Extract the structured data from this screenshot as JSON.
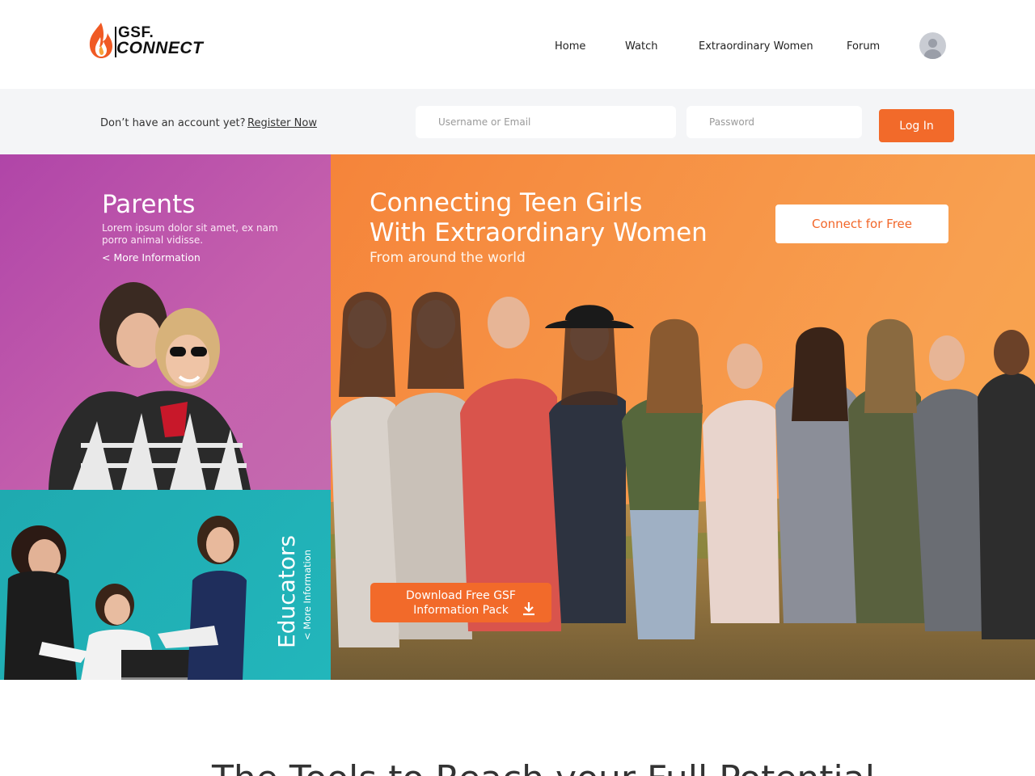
{
  "brand": {
    "name_top": "GSF.",
    "name_bottom": "CONNECT"
  },
  "nav": {
    "home": "Home",
    "watch": "Watch",
    "women": "Extraordinary Women",
    "forum": "Forum"
  },
  "login": {
    "prompt": "Don’t have an account yet?",
    "register_label": "Register Now",
    "username_placeholder": "Username or Email",
    "password_placeholder": "Password",
    "login_label": "Log In"
  },
  "parents": {
    "title": "Parents",
    "description": "Lorem ipsum dolor sit amet, ex nam porro animal vidisse.",
    "more": "< More Information"
  },
  "educators": {
    "title": "Educators",
    "more": "< More Information"
  },
  "hero": {
    "title_line1": "Connecting Teen Girls",
    "title_line2": "With Extraordinary Women",
    "subtitle": "From around the world",
    "connect_label": "Connect for Free",
    "download_line1": "Download Free GSF",
    "download_line2": "Information Pack"
  },
  "bottom": {
    "heading": "The Tools to Reach your Full Potential"
  },
  "colors": {
    "accent": "#f26a2a",
    "parents": "#b748a9",
    "educators": "#20b0b5",
    "hero": "#f5913f"
  }
}
